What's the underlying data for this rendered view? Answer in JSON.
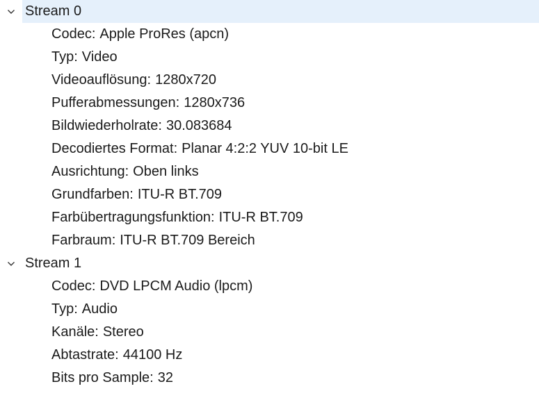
{
  "streams": [
    {
      "label": "Stream 0",
      "expanded": true,
      "selected": true,
      "properties": [
        {
          "key": "Codec:",
          "value": "Apple ProRes (apcn)"
        },
        {
          "key": "Typ:",
          "value": "Video"
        },
        {
          "key": "Videoauflösung:",
          "value": "1280x720"
        },
        {
          "key": "Pufferabmessungen:",
          "value": "1280x736"
        },
        {
          "key": "Bildwiederholrate:",
          "value": "30.083684"
        },
        {
          "key": "Decodiertes Format:",
          "value": "Planar 4:2:2 YUV 10-bit LE"
        },
        {
          "key": "Ausrichtung:",
          "value": "Oben links"
        },
        {
          "key": "Grundfarben:",
          "value": "ITU-R BT.709"
        },
        {
          "key": "Farbübertragungsfunktion:",
          "value": "ITU-R BT.709"
        },
        {
          "key": "Farbraum:",
          "value": "ITU-R BT.709 Bereich"
        }
      ]
    },
    {
      "label": "Stream 1",
      "expanded": true,
      "selected": false,
      "properties": [
        {
          "key": "Codec:",
          "value": "DVD LPCM Audio (lpcm)"
        },
        {
          "key": "Typ:",
          "value": "Audio"
        },
        {
          "key": "Kanäle:",
          "value": "Stereo"
        },
        {
          "key": "Abtastrate:",
          "value": "44100 Hz"
        },
        {
          "key": "Bits pro Sample:",
          "value": "32"
        }
      ]
    }
  ],
  "colors": {
    "selection": "#e5f0fb",
    "text": "#1a1a1a",
    "chevron": "#333333"
  },
  "icons": {
    "expand": "chevron-down-icon"
  }
}
